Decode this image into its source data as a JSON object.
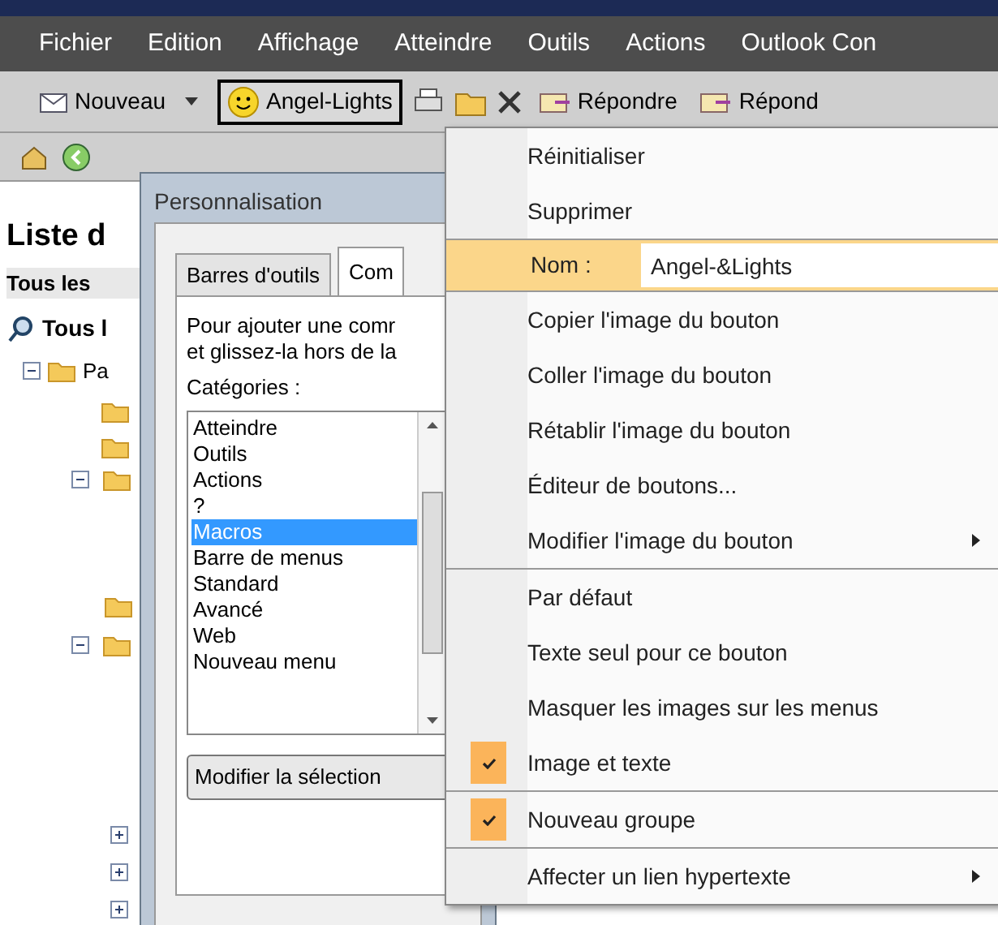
{
  "menu_bar": [
    "Fichier",
    "Edition",
    "Affichage",
    "Atteindre",
    "Outils",
    "Actions",
    "Outlook Con"
  ],
  "toolbar": [
    {
      "kind": "dropdown",
      "label": "Nouveau",
      "selected": false
    },
    {
      "kind": "button",
      "label": "Angel-Lights",
      "selected": true
    }
  ],
  "toolbar_reply": [
    "Répondre",
    "Répond"
  ],
  "left_pane": {
    "title": "Liste d",
    "subtitle": "Tous les",
    "search_item": "Tous l",
    "tree_root": "Pa"
  },
  "dialog": {
    "title": "Personnalisation",
    "tabs": [
      {
        "label": "Barres d'outils",
        "selected": false
      },
      {
        "label": "Com",
        "selected": true
      }
    ],
    "instructions": [
      "Pour ajouter une comr",
      "et glissez-la hors de la"
    ],
    "categories_label": "Catégories :",
    "categories": [
      {
        "label": "Atteindre",
        "selected": false
      },
      {
        "label": "Outils",
        "selected": false
      },
      {
        "label": "Actions",
        "selected": false
      },
      {
        "label": "?",
        "selected": false
      },
      {
        "label": "Macros",
        "selected": true
      },
      {
        "label": "Barre de menus",
        "selected": false
      },
      {
        "label": "Standard",
        "selected": false
      },
      {
        "label": "Avancé",
        "selected": false
      },
      {
        "label": "Web",
        "selected": false
      },
      {
        "label": "Nouveau menu",
        "selected": false
      }
    ],
    "modify_button": "Modifier la sélection"
  },
  "context_menu": [
    [
      {
        "kind": "command",
        "label": "Réinitialiser",
        "checked": false
      },
      {
        "kind": "command",
        "label": "Supprimer",
        "checked": false
      }
    ],
    [
      {
        "kind": "field",
        "label": "Nom :",
        "value": "Angel-&Lights"
      }
    ],
    [
      {
        "kind": "command",
        "label": "Copier l'image du bouton",
        "checked": false
      },
      {
        "kind": "command",
        "label": "Coller l'image du bouton",
        "checked": false
      },
      {
        "kind": "command",
        "label": "Rétablir l'image du bouton",
        "checked": false
      },
      {
        "kind": "command",
        "label": "Éditeur de boutons...",
        "checked": false
      },
      {
        "kind": "submenu",
        "label": "Modifier l'image du bouton"
      }
    ],
    [
      {
        "kind": "command",
        "label": "Par défaut",
        "checked": false
      },
      {
        "kind": "command",
        "label": "Texte seul pour ce bouton",
        "checked": false
      },
      {
        "kind": "command",
        "label": "Masquer les images sur les menus",
        "checked": false
      },
      {
        "kind": "command",
        "label": "Image et texte",
        "checked": true
      }
    ],
    [
      {
        "kind": "command",
        "label": "Nouveau groupe",
        "checked": true
      }
    ],
    [
      {
        "kind": "submenu",
        "label": "Affecter un lien hypertexte"
      }
    ]
  ]
}
